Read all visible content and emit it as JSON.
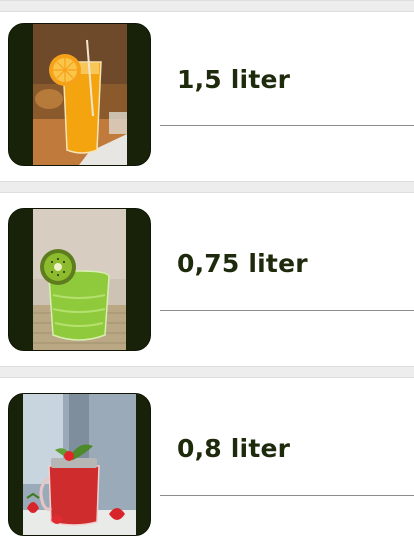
{
  "items": [
    {
      "label": "1,5 liter",
      "image": "orange-juice-photo"
    },
    {
      "label": "0,75 liter",
      "image": "kiwi-juice-photo"
    },
    {
      "label": "0,8 liter",
      "image": "strawberry-juice-photo"
    }
  ],
  "colors": {
    "thumb_frame": "#182208",
    "label_text": "#1e2a0c",
    "separator": "#ededed",
    "divider": "#8c8c8c"
  }
}
